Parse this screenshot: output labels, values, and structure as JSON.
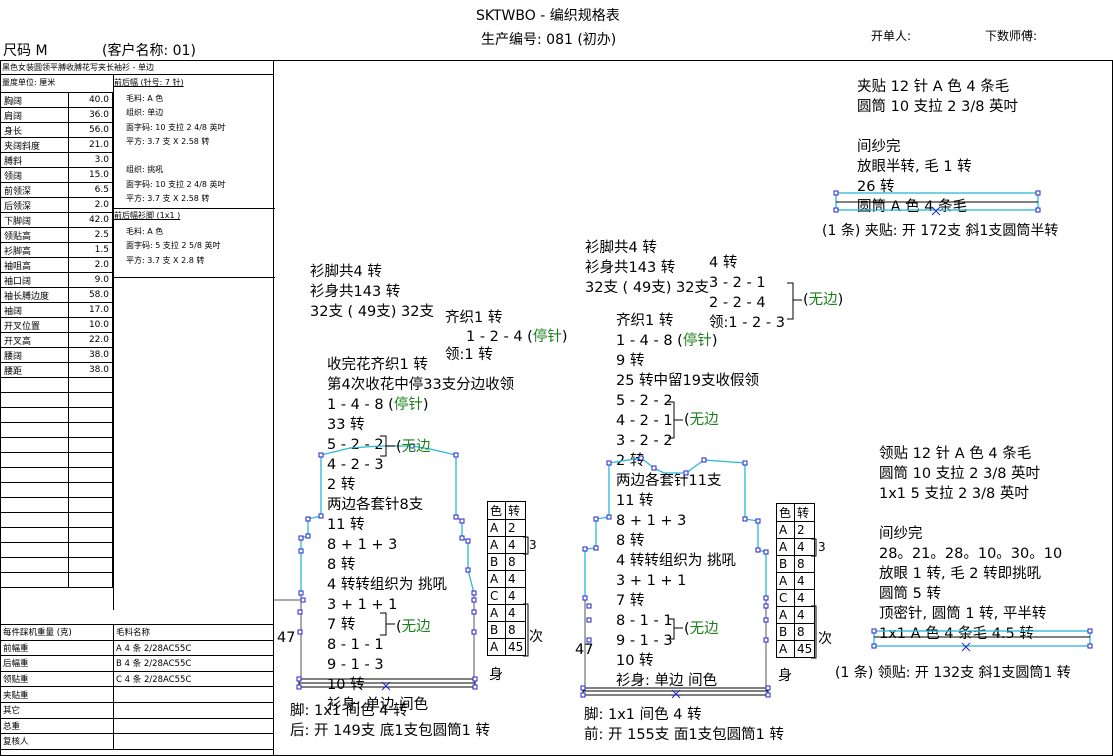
{
  "header": {
    "title": "SKTWBO - 编织规格表",
    "production_no": "生产编号: 081 (初办)",
    "size": "尺码  M",
    "customer": "(客户名称: 01)",
    "issuer_label": "开单人:",
    "master_label": "下数师傅:"
  },
  "spec_panel": {
    "style_name": "黑色女装圆领平膊收膊花写夹长袖衫 - 单边",
    "unit_label": "量度单位: 厘米",
    "rows": [
      {
        "name": "胸阔",
        "value": "40.0"
      },
      {
        "name": "肩阔",
        "value": "36.0"
      },
      {
        "name": "身长",
        "value": "56.0"
      },
      {
        "name": "夹阔斜度",
        "value": "21.0"
      },
      {
        "name": "膊斜",
        "value": "3.0"
      },
      {
        "name": "领阔",
        "value": "15.0"
      },
      {
        "name": "前领深",
        "value": "6.5"
      },
      {
        "name": "后领深",
        "value": "2.0"
      },
      {
        "name": "下脚阔",
        "value": "42.0"
      },
      {
        "name": "领贴高",
        "value": "2.5"
      },
      {
        "name": "衫脚高",
        "value": "1.5"
      },
      {
        "name": "袖咀高",
        "value": "2.0"
      },
      {
        "name": "袖口阔",
        "value": "9.0"
      },
      {
        "name": "袖长膊边度",
        "value": "58.0"
      },
      {
        "name": "袖阔",
        "value": "17.0"
      },
      {
        "name": "开叉位置",
        "value": "10.0"
      },
      {
        "name": "开叉高",
        "value": "22.0"
      },
      {
        "name": "腰阔",
        "value": "38.0"
      },
      {
        "name": "腰距",
        "value": "38.0"
      }
    ],
    "empty_rows": 14
  },
  "yarn_panel": {
    "section1_title": "前后幅 (针号: 7 针)",
    "section1_lines": [
      "毛料: A 色",
      "组织: 单边",
      "面字码: 10 支拉 2 4/8 英吋",
      "平方: 3.7 支 X 2.58 转",
      "",
      "组织: 挑吼",
      "面字码: 10 支拉 2 4/8 英吋",
      "平方: 3.7 支 X 2.58 转"
    ],
    "section2_title": "前后幅衫脚 (1x1 )",
    "section2_lines": [
      "毛料: A 色",
      "面字码: 5 支拉 2 5/8 英吋",
      "平方: 3.7 支 X 2.8 转"
    ]
  },
  "bottom_table": {
    "header": [
      "每件踩机重量 (克)",
      "毛料名称"
    ],
    "rows": [
      {
        "name": "前幅重",
        "yarn": "A  4 条 2/28AC55C"
      },
      {
        "name": "后幅重",
        "yarn": "B  4 条 2/28AC55C"
      },
      {
        "name": "领贴重",
        "yarn": "C  4 条 2/28AC55C"
      },
      {
        "name": "夹贴重",
        "yarn": ""
      },
      {
        "name": "其它",
        "yarn": ""
      },
      {
        "name": "总重",
        "yarn": ""
      },
      {
        "name": "复核人",
        "yarn": ""
      }
    ]
  },
  "armhole_band": {
    "lines": [
      "夹贴  12 针 A 色 4 条毛",
      "圆筒 10 支拉 2 3/8 英吋",
      "",
      "间纱完",
      "放眼半转, 毛 1 转",
      "26 转",
      "圆筒 A 色 4 条毛"
    ],
    "footer": "(1 条) 夹贴: 开 172支 斜1支圆筒半转"
  },
  "neck_band": {
    "lines": [
      "领贴  12 针 A 色 4 条毛",
      "圆筒 10 支拉 2 3/8 英吋",
      "1x1   5 支拉 2 3/8 英吋",
      "",
      "间纱完",
      "28。21。28。10。30。10",
      "放眼 1 转, 毛 2 转即挑吼",
      "圆筒      5 转",
      "顶密针, 圆筒 1 转, 平半转",
      "1x1     A 色 4 条毛     4.5 转"
    ],
    "footer": "(1 条) 领贴: 开 132支 斜1支圆筒1 转"
  },
  "back_panel": {
    "top_lines": [
      "衫脚共4 转",
      "衫身共143 转",
      "32支 ( 49支) 32支"
    ],
    "shoulder_lines": [
      "齐织1 转",
      "1 - 2 - 4 (",
      "停针",
      ")",
      "领:1 转"
    ],
    "body_lines": [
      "收完花齐织1 转",
      "第4次收花中停33支分边收领",
      "1 - 4 - 8 (",
      "33 转",
      "5 - 2 - 2",
      "4 - 2 - 3",
      "2 转",
      "两边各套针8支",
      "11 转",
      "8 + 1 + 3",
      "8 转",
      "4 转转组织为 挑吼",
      "3 + 1 + 1",
      "7 转",
      "8 - 1 - 1",
      "9 - 1 - 3",
      "10 转",
      "衫身: 单边 间色"
    ],
    "stop_label": "停针",
    "no_edge_label": "无边",
    "side_length": "47",
    "bottom_lines": [
      "脚: 1x1     间色 4 转",
      "后: 开 149支 底1支包圆筒1 转"
    ]
  },
  "front_panel": {
    "top_lines": [
      "衫脚共4 转",
      "衫身共143 转",
      "32支 ( 49支) 32支"
    ],
    "neck_lines": [
      "4 转",
      "3 - 2 - 1",
      "2 - 2 - 4",
      "领:1 - 2 - 3"
    ],
    "body_lines": [
      "齐织1 转",
      "1 - 4 - 8 (",
      "9 转",
      "25 转中留19支收假领",
      "5 - 2 - 2",
      "4 - 2 - 1",
      "3 - 2 - 2",
      "2 转",
      "两边各套针11支",
      "11 转",
      "8 + 1 + 3",
      "8 转",
      "4 转转组织为 挑吼",
      "3 + 1 + 1",
      "7 转",
      "8 - 1 - 1",
      "9 - 1 - 3",
      "10 转",
      "衫身: 单边 间色"
    ],
    "stop_label": "停针",
    "no_edge_label": "无边",
    "side_length": "47",
    "bottom_lines": [
      "脚: 1x1     间色 4 转",
      "前: 开 155支 面1支包圆筒1 转"
    ]
  },
  "color_table": {
    "header": [
      "色",
      "转"
    ],
    "rows": [
      [
        "A",
        "2"
      ],
      [
        "A",
        "4"
      ],
      [
        "B",
        "8"
      ],
      [
        "A",
        "4"
      ],
      [
        "C",
        "4"
      ],
      [
        "A",
        "4"
      ],
      [
        "B",
        "8"
      ],
      [
        "A",
        "45"
      ]
    ],
    "bracket_3": "3",
    "times_label": "次",
    "body_label": "身"
  },
  "colors": {
    "outline": "#2ab8d6",
    "node": "#2222cc",
    "green": "#1a7f1a"
  }
}
